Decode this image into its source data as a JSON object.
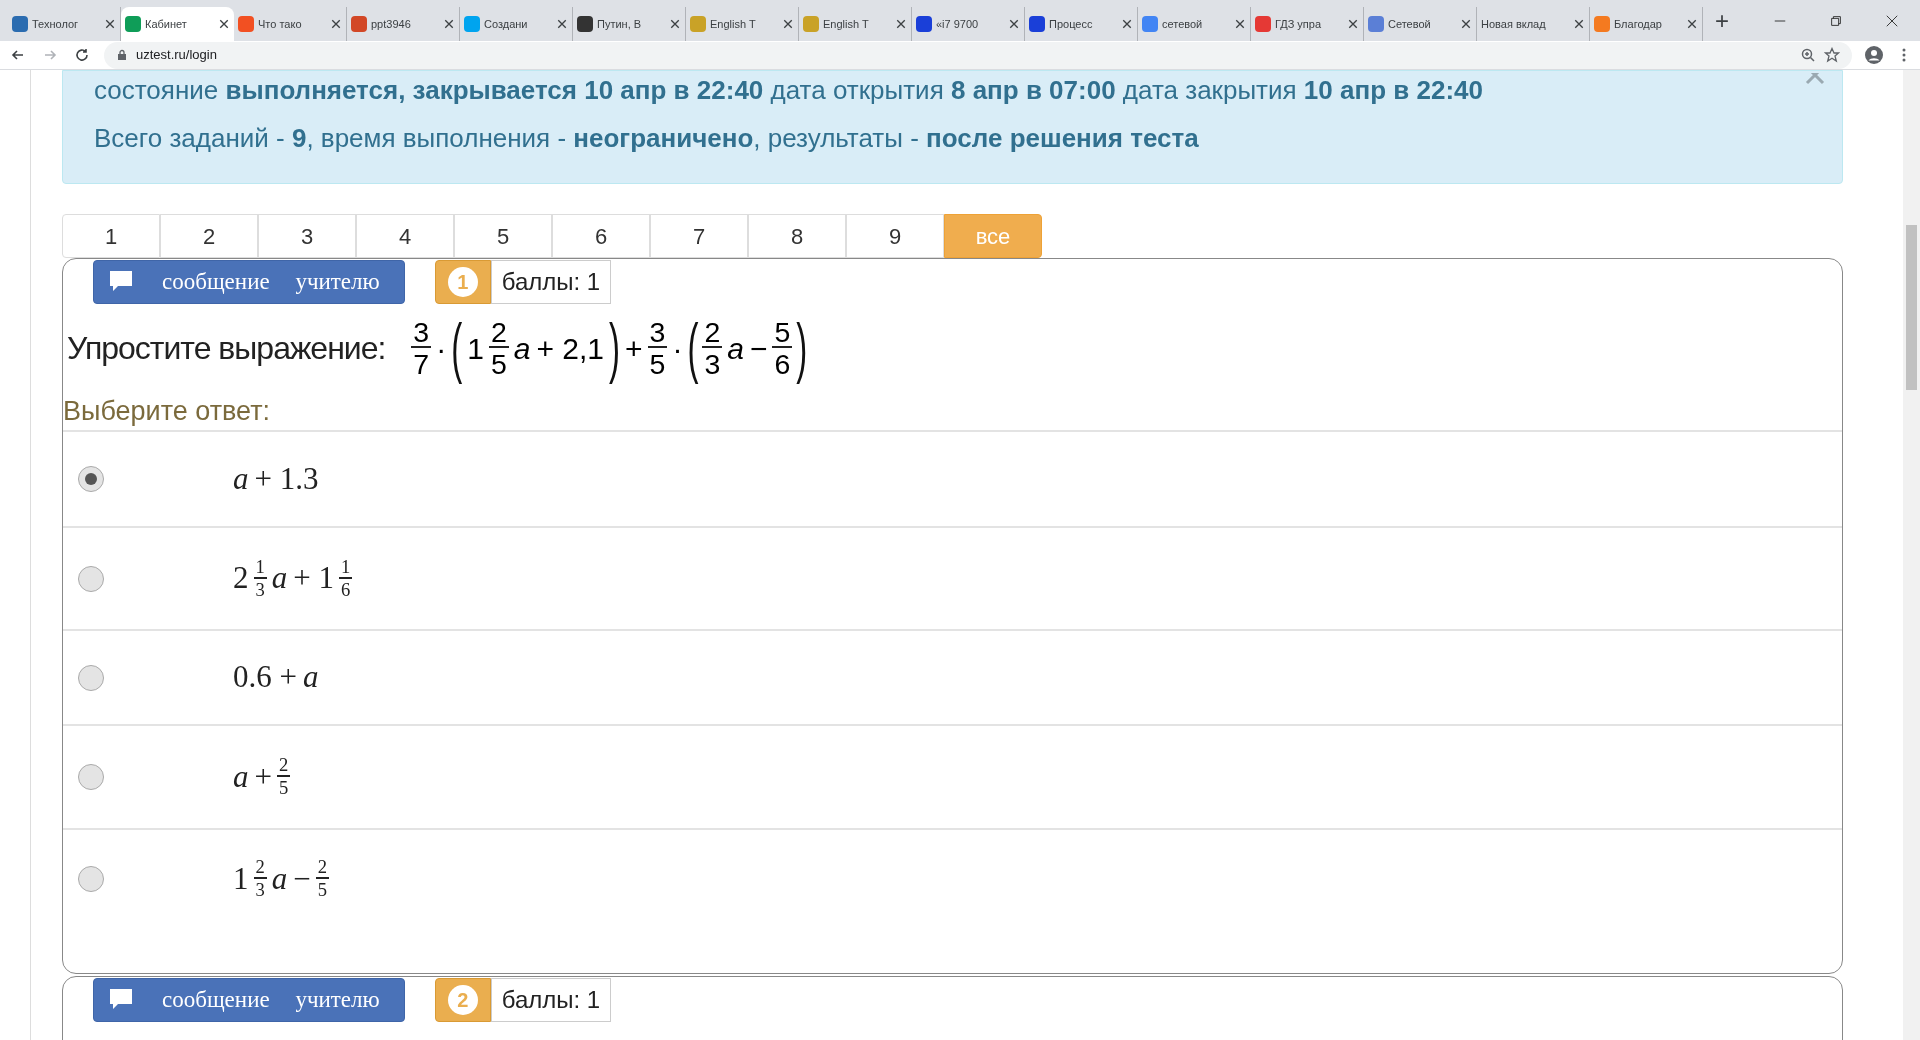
{
  "browser": {
    "tabs": [
      {
        "label": "Технолог",
        "selected": false
      },
      {
        "label": "Кабинет",
        "selected": true
      },
      {
        "label": "Что тако",
        "selected": false
      },
      {
        "label": "ppt3946",
        "selected": false
      },
      {
        "label": "Создани",
        "selected": false
      },
      {
        "label": "Путин, В",
        "selected": false
      },
      {
        "label": "English T",
        "selected": false
      },
      {
        "label": "English T",
        "selected": false
      },
      {
        "label": "«i7 9700",
        "selected": false
      },
      {
        "label": "Процесс",
        "selected": false
      },
      {
        "label": "сетевой",
        "selected": false
      },
      {
        "label": "ГДЗ упра",
        "selected": false
      },
      {
        "label": "Сетевой",
        "selected": false
      },
      {
        "label": "Новая вклад",
        "selected": false
      },
      {
        "label": "Благодар",
        "selected": false
      }
    ],
    "new_tab": "+",
    "url": "uztest.ru/login"
  },
  "info": {
    "lines": [
      "состояние **выполняется, закрывается 10 апр в 22:40** дата открытия **8 апр в 07:00** дата закрытия **10 апр в 22:40**",
      "Всего заданий - **9**, время выполнения - **неограничено**, результаты - **после решения теста**"
    ]
  },
  "task_nav": [
    {
      "label": "1",
      "selected": false
    },
    {
      "label": "2",
      "selected": false
    },
    {
      "label": "3",
      "selected": false
    },
    {
      "label": "4",
      "selected": false
    },
    {
      "label": "5",
      "selected": false
    },
    {
      "label": "6",
      "selected": false
    },
    {
      "label": "7",
      "selected": false
    },
    {
      "label": "8",
      "selected": false
    },
    {
      "label": "9",
      "selected": false
    },
    {
      "label": "все",
      "selected": true
    }
  ],
  "questions": [
    {
      "message_button": "сообщение учителю",
      "number": "1",
      "score": "баллы: 1",
      "prompt": "Упростите выражение:",
      "expression": [
        {
          "kind": "frac",
          "num": "3",
          "den": "7"
        },
        {
          "kind": "text",
          "text": "·"
        },
        {
          "kind": "paren",
          "text": "("
        },
        {
          "kind": "text",
          "text": "1"
        },
        {
          "kind": "frac",
          "num": "2",
          "den": "5"
        },
        {
          "kind": "var",
          "text": "a"
        },
        {
          "kind": "text",
          "text": "+ 2,1"
        },
        {
          "kind": "paren",
          "text": ")"
        },
        {
          "kind": "text",
          "text": "+"
        },
        {
          "kind": "frac",
          "num": "3",
          "den": "5"
        },
        {
          "kind": "text",
          "text": "·"
        },
        {
          "kind": "paren",
          "text": "("
        },
        {
          "kind": "frac",
          "num": "2",
          "den": "3"
        },
        {
          "kind": "var",
          "text": "a"
        },
        {
          "kind": "text",
          "text": "−"
        },
        {
          "kind": "frac",
          "num": "5",
          "den": "6"
        },
        {
          "kind": "paren",
          "text": ")"
        }
      ],
      "answer_label": "Выберите ответ:",
      "options": [
        {
          "selected": true,
          "math": [
            {
              "kind": "var",
              "text": "a"
            },
            {
              "kind": "text",
              "text": "+ 1.3"
            }
          ]
        },
        {
          "selected": false,
          "math": [
            {
              "kind": "text",
              "text": "2"
            },
            {
              "kind": "frac",
              "num": "1",
              "den": "3"
            },
            {
              "kind": "var",
              "text": "a"
            },
            {
              "kind": "text",
              "text": "+ 1"
            },
            {
              "kind": "frac",
              "num": "1",
              "den": "6"
            }
          ]
        },
        {
          "selected": false,
          "math": [
            {
              "kind": "text",
              "text": "0.6 +"
            },
            {
              "kind": "var",
              "text": "a"
            }
          ]
        },
        {
          "selected": false,
          "math": [
            {
              "kind": "var",
              "text": "a"
            },
            {
              "kind": "text",
              "text": "+"
            },
            {
              "kind": "frac",
              "num": "2",
              "den": "5"
            }
          ]
        },
        {
          "selected": false,
          "math": [
            {
              "kind": "text",
              "text": "1"
            },
            {
              "kind": "frac",
              "num": "2",
              "den": "3"
            },
            {
              "kind": "var",
              "text": "a"
            },
            {
              "kind": "text",
              "text": "−"
            },
            {
              "kind": "frac",
              "num": "2",
              "den": "5"
            }
          ]
        }
      ]
    },
    {
      "message_button": "сообщение учителю",
      "number": "2",
      "score": "баллы: 1"
    }
  ]
}
